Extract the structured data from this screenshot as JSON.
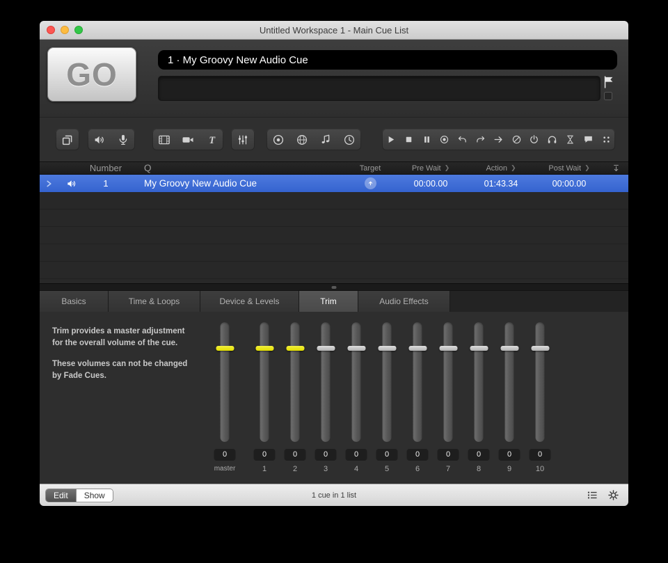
{
  "window": {
    "title": "Untitled Workspace 1 - Main Cue List",
    "traffic_lights": [
      "close",
      "minimize",
      "zoom"
    ]
  },
  "header": {
    "go_button": "GO",
    "cue_name_field": "1 · My Groovy New Audio Cue",
    "notes_field": "",
    "flag_icon": "flag"
  },
  "toolbar": {
    "cue_groups": [
      {
        "name": "group-cue-tools",
        "transport": false,
        "icons": [
          "group-cue"
        ]
      },
      {
        "name": "audio-cue-tools",
        "transport": false,
        "icons": [
          "audio-cue",
          "mic-cue"
        ]
      },
      {
        "name": "video-cue-tools",
        "transport": false,
        "icons": [
          "video-cue",
          "camera-cue",
          "text-cue"
        ]
      },
      {
        "name": "fade-cue-tools",
        "transport": false,
        "icons": [
          "fade-cue"
        ]
      },
      {
        "name": "control-cue-tools",
        "transport": false,
        "icons": [
          "osc-cue",
          "network-cue",
          "midi-cue",
          "timecode-cue"
        ]
      },
      {
        "name": "transport-tools",
        "transport": true,
        "icons": [
          "play",
          "stop",
          "pause",
          "record",
          "undo",
          "redo",
          "load",
          "devamp",
          "power",
          "preview",
          "wait",
          "notes",
          "all-cues"
        ]
      }
    ]
  },
  "cue_list": {
    "headers": {
      "number": "Number",
      "q": "Q",
      "target": "Target",
      "pre_wait": "Pre Wait",
      "action": "Action",
      "post_wait": "Post Wait"
    },
    "header_icon": "sort",
    "rows": [
      {
        "selected": true,
        "playhead": true,
        "type_icon": "audio-cue",
        "number": "1",
        "name": "My Groovy New Audio Cue",
        "target_icon": "target-up",
        "pre_wait": "00:00.00",
        "action": "01:43.34",
        "post_wait": "00:00.00"
      }
    ]
  },
  "inspector": {
    "tabs": [
      {
        "label": "Basics",
        "active": false
      },
      {
        "label": "Time & Loops",
        "active": false
      },
      {
        "label": "Device & Levels",
        "active": false
      },
      {
        "label": "Trim",
        "active": true
      },
      {
        "label": "Audio Effects",
        "active": false
      }
    ],
    "trim": {
      "description": [
        "Trim provides a master adjustment for the overall volume of the cue.",
        "These volumes can not be changed by Fade Cues."
      ],
      "channels": [
        {
          "label": "master",
          "value": "0",
          "highlighted": true
        },
        {
          "label": "1",
          "value": "0",
          "highlighted": true
        },
        {
          "label": "2",
          "value": "0",
          "highlighted": true
        },
        {
          "label": "3",
          "value": "0",
          "highlighted": false
        },
        {
          "label": "4",
          "value": "0",
          "highlighted": false
        },
        {
          "label": "5",
          "value": "0",
          "highlighted": false
        },
        {
          "label": "6",
          "value": "0",
          "highlighted": false
        },
        {
          "label": "7",
          "value": "0",
          "highlighted": false
        },
        {
          "label": "8",
          "value": "0",
          "highlighted": false
        },
        {
          "label": "9",
          "value": "0",
          "highlighted": false
        },
        {
          "label": "10",
          "value": "0",
          "highlighted": false
        }
      ]
    }
  },
  "status_bar": {
    "mode_toggle": [
      {
        "label": "Edit",
        "active": true
      },
      {
        "label": "Show",
        "active": false
      }
    ],
    "summary": "1 cue in 1 list",
    "icons": [
      "cue-lists",
      "settings"
    ]
  },
  "colors": {
    "selection_blue": "#3563cf",
    "trim_highlight_yellow": "#e2de00"
  }
}
